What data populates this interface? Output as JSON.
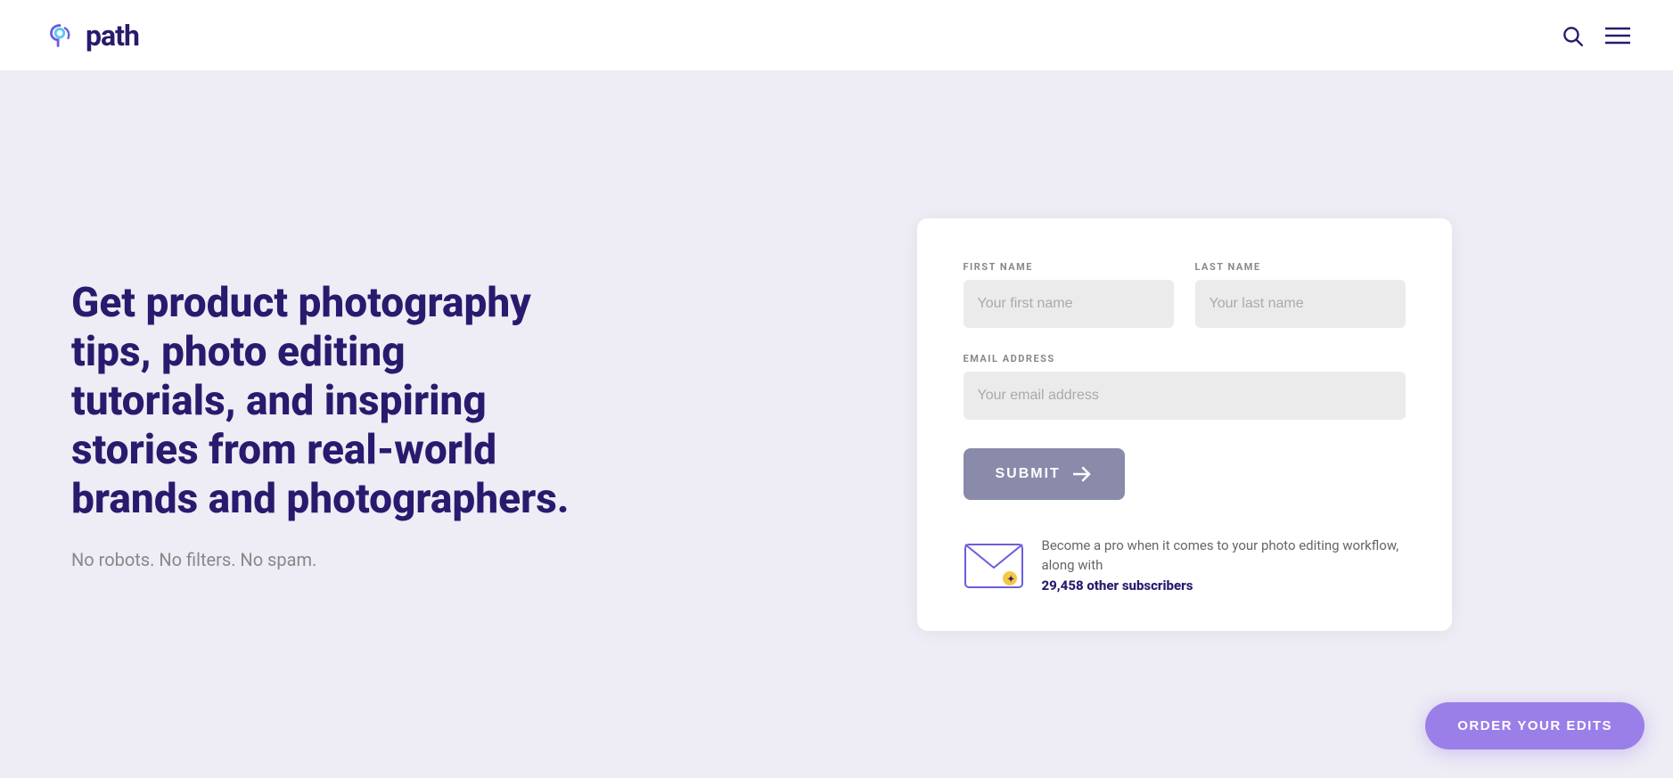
{
  "header": {
    "logo_text": "path",
    "logo_icon_label": "path-logo-icon"
  },
  "hero": {
    "heading": "Get product photography tips, photo editing tutorials, and inspiring stories from real-world brands and photographers.",
    "subtext": "No robots. No filters. No spam."
  },
  "form": {
    "first_name_label": "FIRST NAME",
    "first_name_placeholder": "Your first name",
    "last_name_label": "LAST NAME",
    "last_name_placeholder": "Your last name",
    "email_label": "EMAIL ADDRESS",
    "email_placeholder": "Your email address",
    "submit_label": "SUBMIT"
  },
  "promo": {
    "text": "Become a pro when it comes to your photo editing workflow, along with",
    "subscribers": "29,458 other subscribers"
  },
  "order_btn": {
    "label": "ORDER YOUR EDITS"
  }
}
